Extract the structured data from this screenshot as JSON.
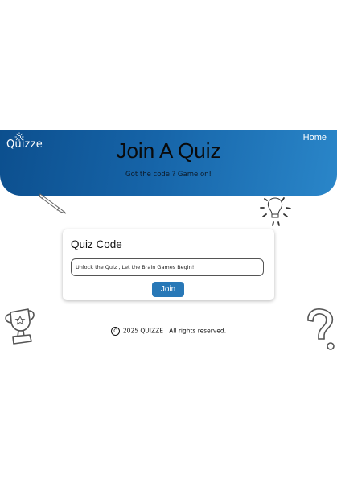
{
  "header": {
    "logo_text": "Quizze",
    "home_label": "Home",
    "title": "Join A Quiz",
    "subtitle": "Got the code ? Game on!"
  },
  "join_card": {
    "title": "Quiz Code",
    "input_placeholder": "Unlock the Quiz , Let the Brain Games Begin!",
    "input_value": "",
    "join_label": "Join"
  },
  "footer": {
    "copyright_symbol": "C",
    "text": "2025 QUIZZE . All rights reserved."
  },
  "icons": {
    "logo_spark": "spark-icon",
    "pencil": "pencil-icon",
    "bulb": "lightbulb-icon",
    "trophy": "trophy-icon",
    "question": "question-mark-icon"
  },
  "colors": {
    "banner_start": "#0c4f8e",
    "banner_end": "#2a86c9",
    "button": "#2878b7",
    "text_light": "#ffffff"
  }
}
